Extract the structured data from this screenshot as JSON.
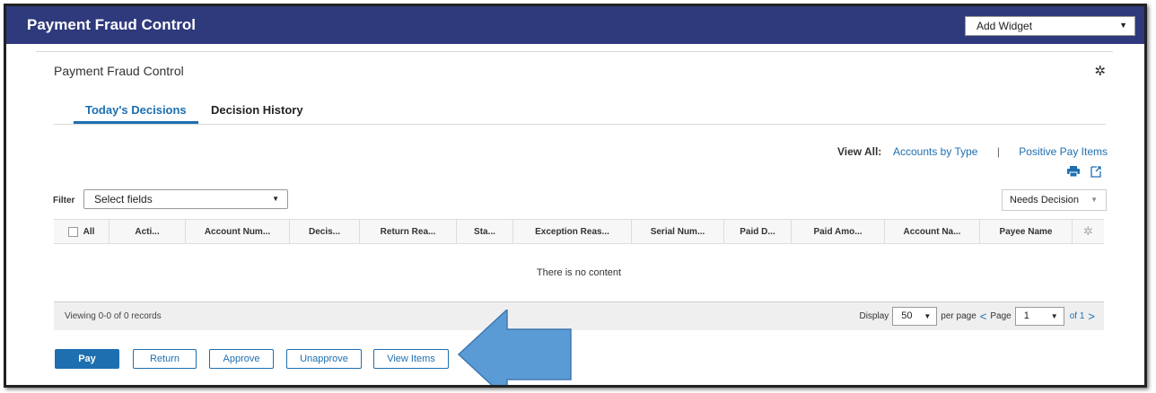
{
  "header": {
    "title": "Payment Fraud Control",
    "add_widget": "Add Widget"
  },
  "widget": {
    "title": "Payment Fraud Control"
  },
  "tabs": [
    {
      "label": "Today's Decisions",
      "active": true
    },
    {
      "label": "Decision History",
      "active": false
    }
  ],
  "view_all": {
    "label": "View All:",
    "links": [
      "Accounts by Type",
      "Positive Pay Items"
    ],
    "separator": "|"
  },
  "filter": {
    "label": "Filter",
    "placeholder": "Select fields",
    "status_select": "Needs Decision"
  },
  "grid": {
    "columns": [
      "All",
      "Acti...",
      "Account Num...",
      "Decis...",
      "Return Rea...",
      "Sta...",
      "Exception Reas...",
      "Serial Num...",
      "Paid D...",
      "Paid Amo...",
      "Account Na...",
      "Payee Name"
    ],
    "empty_message": "There is no content"
  },
  "footer": {
    "viewing": "Viewing 0-0 of 0 records",
    "display_label": "Display",
    "per_page_value": "50",
    "per_page_label": "per page",
    "page_label": "Page",
    "page_value": "1",
    "of_label": "of 1"
  },
  "actions": {
    "pay": "Pay",
    "return": "Return",
    "approve": "Approve",
    "unapprove": "Unapprove",
    "view_items": "View Items"
  },
  "colors": {
    "titlebar": "#2f3a7c",
    "accent": "#1d6fb0",
    "arrow": "#5b9bd5"
  },
  "icons": [
    "gear-icon",
    "print-icon",
    "export-icon",
    "chevron-down-icon",
    "chevron-left-icon",
    "chevron-right-icon",
    "callout-arrow-icon"
  ]
}
